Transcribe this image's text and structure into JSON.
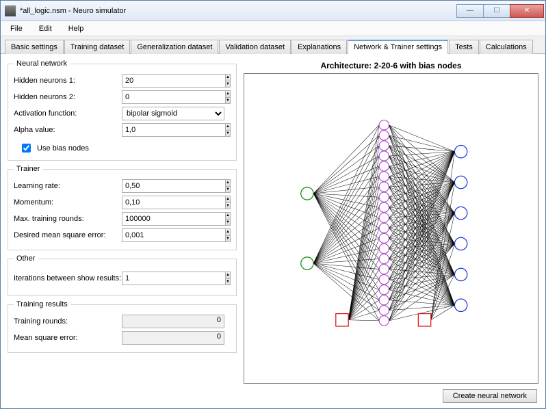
{
  "window": {
    "title": "*all_logic.nsm - Neuro simulator"
  },
  "menu": {
    "file": "File",
    "edit": "Edit",
    "help": "Help"
  },
  "tabs": {
    "basic": "Basic settings",
    "training": "Training dataset",
    "generalization": "Generalization dataset",
    "validation": "Validation dataset",
    "explanations": "Explanations",
    "network": "Network & Trainer settings",
    "tests": "Tests",
    "calculations": "Calculations"
  },
  "nn": {
    "legend": "Neural network",
    "hidden1_label": "Hidden neurons 1:",
    "hidden1_value": "20",
    "hidden2_label": "Hidden neurons 2:",
    "hidden2_value": "0",
    "activation_label": "Activation function:",
    "activation_value": "bipolar sigmoid",
    "alpha_label": "Alpha value:",
    "alpha_value": "1,0",
    "bias_label": "Use bias nodes",
    "bias_checked": true
  },
  "trainer": {
    "legend": "Trainer",
    "lr_label": "Learning rate:",
    "lr_value": "0,50",
    "mom_label": "Momentum:",
    "mom_value": "0,10",
    "max_label": "Max. training rounds:",
    "max_value": "100000",
    "mse_label": "Desired mean square error:",
    "mse_value": "0,001"
  },
  "other": {
    "legend": "Other",
    "iter_label": "Iterations between show results:",
    "iter_value": "1"
  },
  "results": {
    "legend": "Training results",
    "rounds_label": "Training rounds:",
    "rounds_value": "0",
    "mse_label": "Mean square error:",
    "mse_value": "0"
  },
  "arch": {
    "title": "Architecture: 2-20-6 with bias nodes"
  },
  "buttons": {
    "create": "Create neural network"
  },
  "net": {
    "input_count": 2,
    "hidden_count": 20,
    "output_count": 6,
    "bias": true
  }
}
